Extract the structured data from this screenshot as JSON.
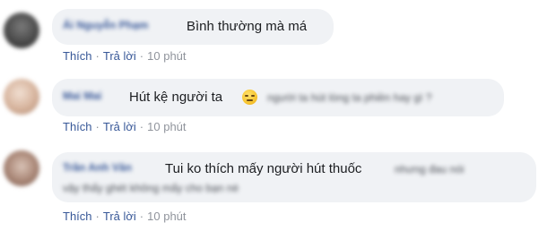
{
  "comments": [
    {
      "author": "Ái Nguyễn Phạm",
      "text": "Bình thường mà má",
      "emoji": "",
      "trailing_text": "",
      "second_line": "",
      "like_label": "Thích",
      "reply_label": "Trả lời",
      "time": "10 phút",
      "avatar_color": "#4a4a4a"
    },
    {
      "author": "Mai Mai",
      "text": "Hút kệ người ta",
      "emoji": "sad-face-emoji",
      "trailing_text": "người ta hút lòng ta phiền hay gì ?",
      "second_line": "",
      "like_label": "Thích",
      "reply_label": "Trả lời",
      "time": "10 phút",
      "avatar_color": "#c9a48a"
    },
    {
      "author": "Trần Anh Văn",
      "text": "Tui ko thích mấy người hút thuốc",
      "emoji": "",
      "trailing_text": "nhưng đau nói",
      "second_line": "vậy thấy ghét không mấy cho bạn nè",
      "like_label": "Thích",
      "reply_label": "Trả lời",
      "time": "10 phút",
      "avatar_color": "#8a6a5a"
    }
  ],
  "colors": {
    "link": "#385898",
    "bubble": "#f0f2f5",
    "meta": "#90949c"
  }
}
